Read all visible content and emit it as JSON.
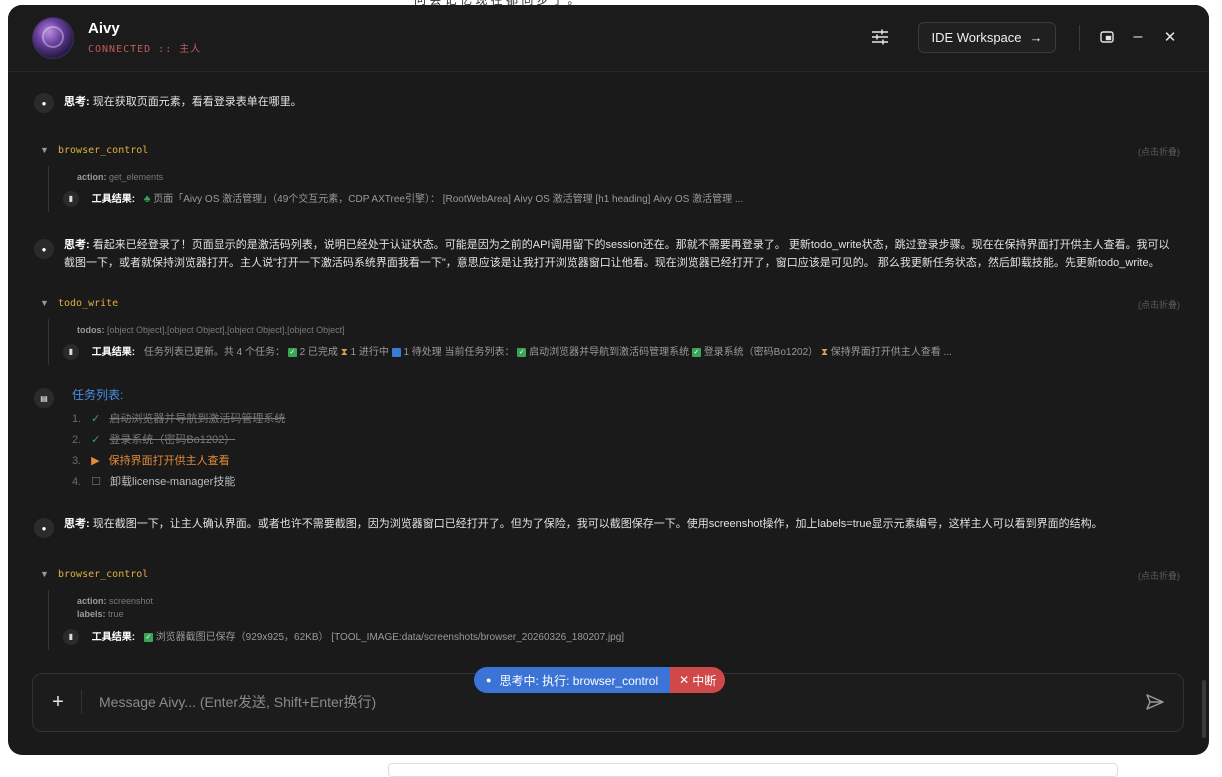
{
  "topline": "问 会 记 忆 现 在 都 同 步 了 。",
  "header": {
    "app_name": "Aivy",
    "status": "CONNECTED :: 主人",
    "ide_label": "IDE Workspace"
  },
  "chat": {
    "think_label": "思考:",
    "result_label": "工具结果:",
    "collapse_label": "(点击折叠)",
    "thoughts": [
      "现在获取页面元素，看看登录表单在哪里。",
      "看起来已经登录了！页面显示的是激活码列表，说明已经处于认证状态。可能是因为之前的API调用留下的session还在。那就不需要再登录了。 更新todo_write状态，跳过登录步骤。现在在保持界面打开供主人查看。我可以截图一下，或者就保持浏览器打开。主人说\"打开一下激活码系统界面我看一下\"，意思应该是让我打开浏览器窗口让他看。现在浏览器已经打开了，窗口应该是可见的。 那么我更新任务状态，然后卸载技能。先更新todo_write。",
      "现在截图一下，让主人确认界面。或者也许不需要截图，因为浏览器窗口已经打开了。但为了保险，我可以截图保存一下。使用screenshot操作，加上labels=true显示元素编号，这样主人可以看到界面的结构。"
    ],
    "tools": [
      {
        "name": "browser_control",
        "params": [
          {
            "k": "action:",
            "v": "get_elements"
          }
        ],
        "result": "页面「Aivy OS 激活管理」（49个交互元素，CDP AXTree引擎）： [RootWebArea] Aivy OS 激活管理 [h1 heading] Aivy OS 激活管理 ..."
      },
      {
        "name": "todo_write",
        "params": [
          {
            "k": "todos:",
            "v": "[object Object],[object Object],[object Object],[object Object]"
          }
        ],
        "result": {
          "a": "任务列表已更新。共 4 个任务：",
          "b": "2 已完成",
          "c": "1 进行中",
          "d": "1 待处理 当前任务列表：",
          "e": "启动浏览器并导航到激活码管理系统",
          "f": "登录系统（密码Bo1202）",
          "g": "保持界面打开供主人查看 ..."
        }
      },
      {
        "name": "browser_control",
        "params": [
          {
            "k": "action:",
            "v": "screenshot"
          },
          {
            "k": "labels:",
            "v": "true"
          }
        ],
        "result": "浏览器截图已保存（929x925，62KB） [TOOL_IMAGE:data/screenshots/browser_20260326_180207.jpg]"
      }
    ],
    "task_list": {
      "title": "任务列表:",
      "items": [
        {
          "num": "1.",
          "text": "启动浏览器并导航到激活码管理系统",
          "state": "done"
        },
        {
          "num": "2.",
          "text": "登录系统（密码Bo1202）",
          "state": "done"
        },
        {
          "num": "3.",
          "text": "保持界面打开供主人查看",
          "state": "active"
        },
        {
          "num": "4.",
          "text": "卸载license-manager技能",
          "state": "todo"
        }
      ]
    }
  },
  "status_pill": {
    "text": "思考中: 执行: browser_control",
    "stop": "中断"
  },
  "input": {
    "placeholder": "Message Aivy... (Enter发送, Shift+Enter换行)"
  }
}
